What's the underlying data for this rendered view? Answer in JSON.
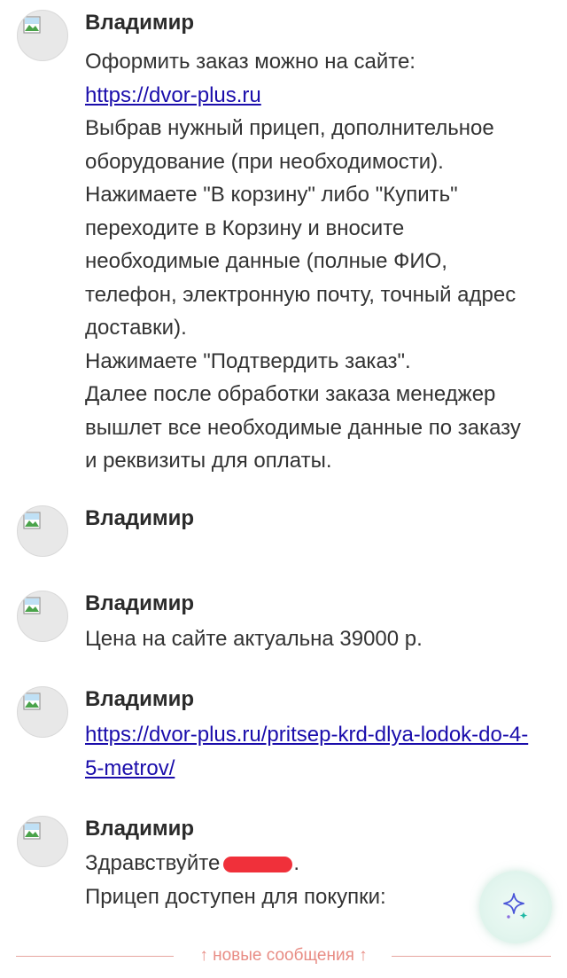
{
  "messages": [
    {
      "author": "Владимир",
      "lines": [
        "Оформить заказ можно на сайте:",
        "https://dvor-plus.ru",
        "Выбрав нужный прицеп, дополнительное",
        "оборудование (при необходимости).",
        "Нажимаете \"В корзину\" либо \"Купить\"",
        "переходите в Корзину и вносите",
        "необходимые данные (полные ФИО,",
        "телефон, электронную почту, точный адрес",
        "доставки).",
        "Нажимаете \"Подтвердить заказ\".",
        "Далее после обработки заказа менеджер",
        "вышлет все необходимые данные по заказу",
        "и реквизиты для оплаты."
      ]
    },
    {
      "author": "Владимир"
    },
    {
      "author": "Владимир",
      "text": "Цена на сайте актуальна 39000 р."
    },
    {
      "author": "Владимир",
      "link_line1": "https://dvor-plus.ru/pritsep-krd-dlya-lodok-do-4-",
      "link_line2": "5-metrov/"
    },
    {
      "author": "Владимир",
      "greeting": "Здравствуйте",
      "greeting_end": ".",
      "text": "Прицеп доступен для покупки:"
    }
  ],
  "new_messages_label": "↑ новые сообщения ↑",
  "colors": {
    "link": "#1a0dab",
    "redaction": "#f0303a",
    "divider": "#e88c84"
  },
  "icons": {
    "avatar": "broken-image-icon",
    "ai": "sparkle-icon"
  }
}
